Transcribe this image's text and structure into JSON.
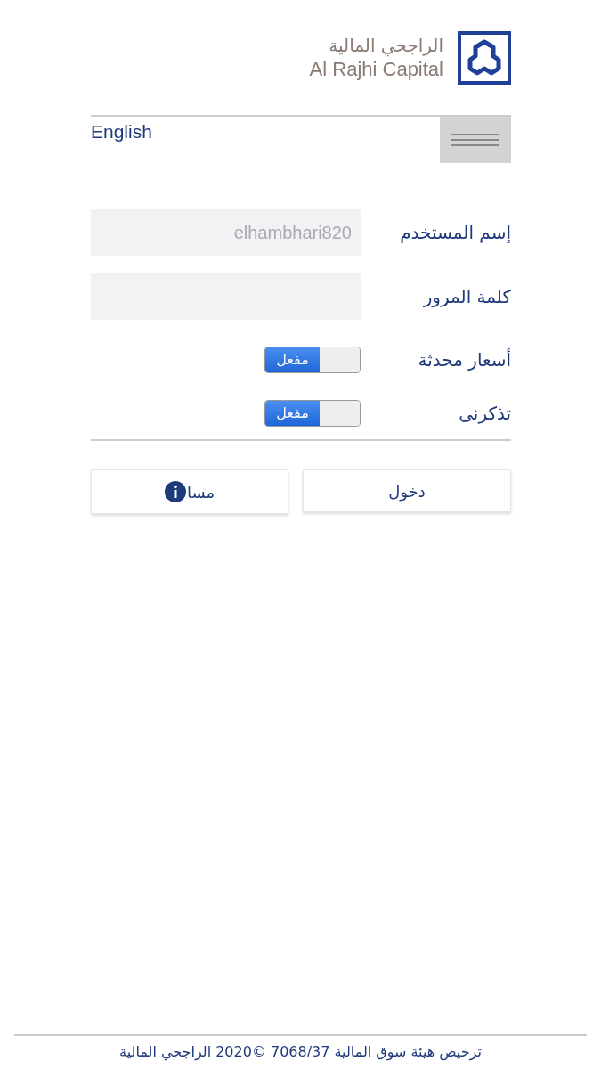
{
  "logo": {
    "arabic_name": "الراجحي المالية",
    "english_name": "Al Rajhi Capital"
  },
  "language_link": "English",
  "form": {
    "username": {
      "label": "إسم المستخدم",
      "value": "elhambhari820"
    },
    "password": {
      "label": "كلمة المرور"
    },
    "toggles": [
      {
        "label": "أسعار محدثة",
        "on": true,
        "state_text": "مفعل"
      },
      {
        "label": "تذكرنى",
        "on": true,
        "state_text": "مفعل"
      }
    ]
  },
  "buttons": {
    "login": "دخول",
    "help": "مسا"
  },
  "footer": "ترخيص هيئة سوق المالية 7068/37 ©2020 الراجحي المالية"
}
